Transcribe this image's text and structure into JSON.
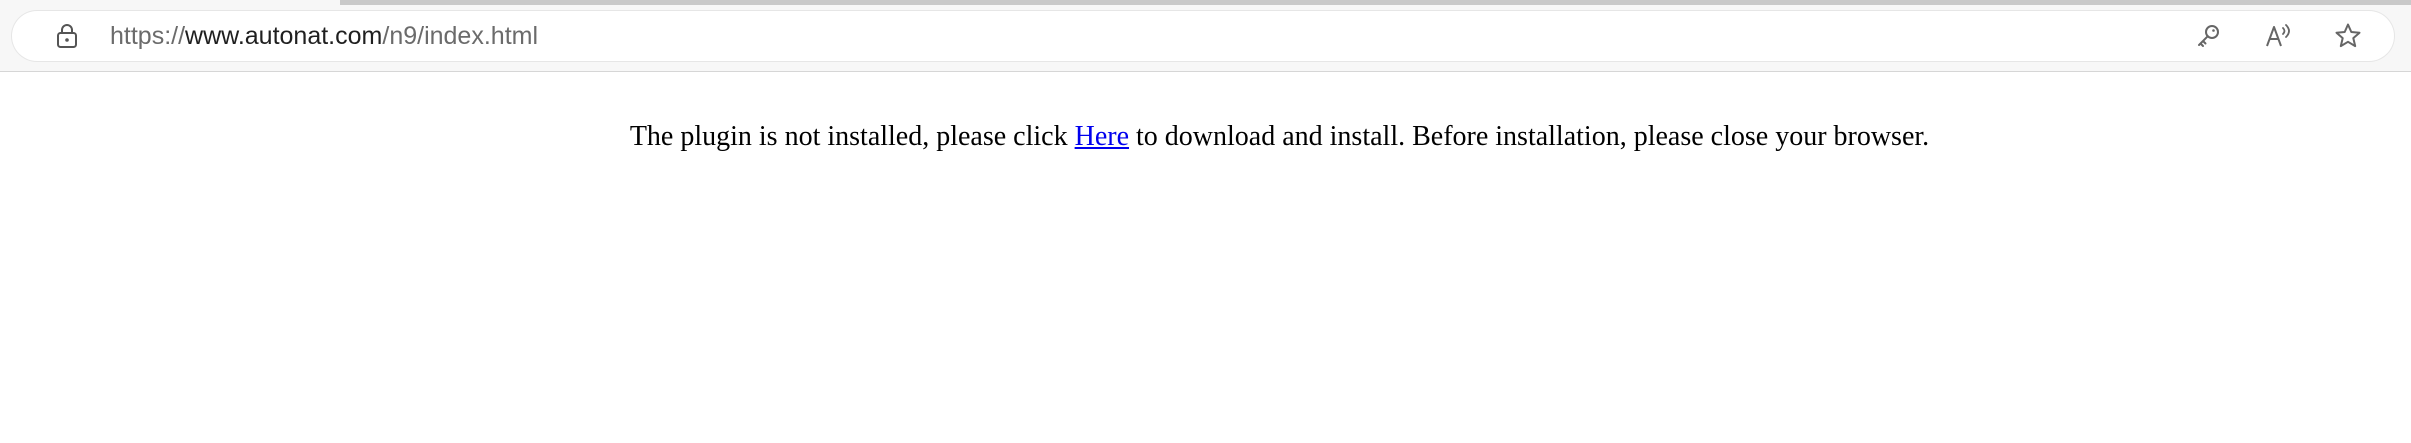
{
  "browser": {
    "url_prefix": "https://",
    "url_domain": "www.autonat.com",
    "url_path": "/n9/index.html",
    "icons": [
      "lock-icon",
      "key-icon",
      "read-aloud-icon",
      "favorite-icon"
    ]
  },
  "page": {
    "notice_before": "The plugin is not installed, please click ",
    "link_text": "Here",
    "notice_after": " to download and install. Before installation, please close your browser."
  },
  "colors": {
    "link": "#0000ee",
    "text": "#000000",
    "chrome_bg": "#f7f7f7"
  }
}
